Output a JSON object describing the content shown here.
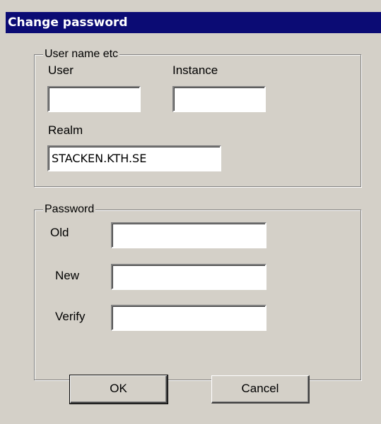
{
  "window": {
    "title": "Change password"
  },
  "user_group": {
    "legend": "User  name etc",
    "user_label": "User",
    "user_value": "",
    "instance_label": "Instance",
    "instance_value": "",
    "realm_label": "Realm",
    "realm_value": "STACKEN.KTH.SE"
  },
  "password_group": {
    "legend": "Password",
    "old_label": "Old",
    "old_value": "",
    "new_label": "New",
    "new_value": "",
    "verify_label": "Verify",
    "verify_value": ""
  },
  "buttons": {
    "ok_label": "OK",
    "cancel_label": "Cancel"
  }
}
